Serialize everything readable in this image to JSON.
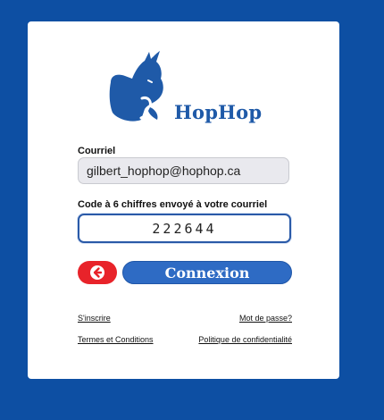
{
  "brand": {
    "name": "HopHop"
  },
  "form": {
    "email_label": "Courriel",
    "email_value": "gilbert_hophop@hophop.ca",
    "code_label": "Code à 6 chiffres envoyé à votre courriel",
    "code_value": "222644",
    "login_label": "Connexion"
  },
  "links": {
    "signup": "S'inscrire",
    "password": "Mot de passe?",
    "terms": "Termes et Conditions",
    "privacy": "Politique de confidentialité"
  },
  "colors": {
    "background": "#0d4fa3",
    "brand": "#1f5aa8",
    "primary_button": "#2e6bc4",
    "back_button": "#e8232a"
  },
  "icons": {
    "logo": "hophop-kangaroo-logo",
    "back": "arrow-left-icon"
  }
}
